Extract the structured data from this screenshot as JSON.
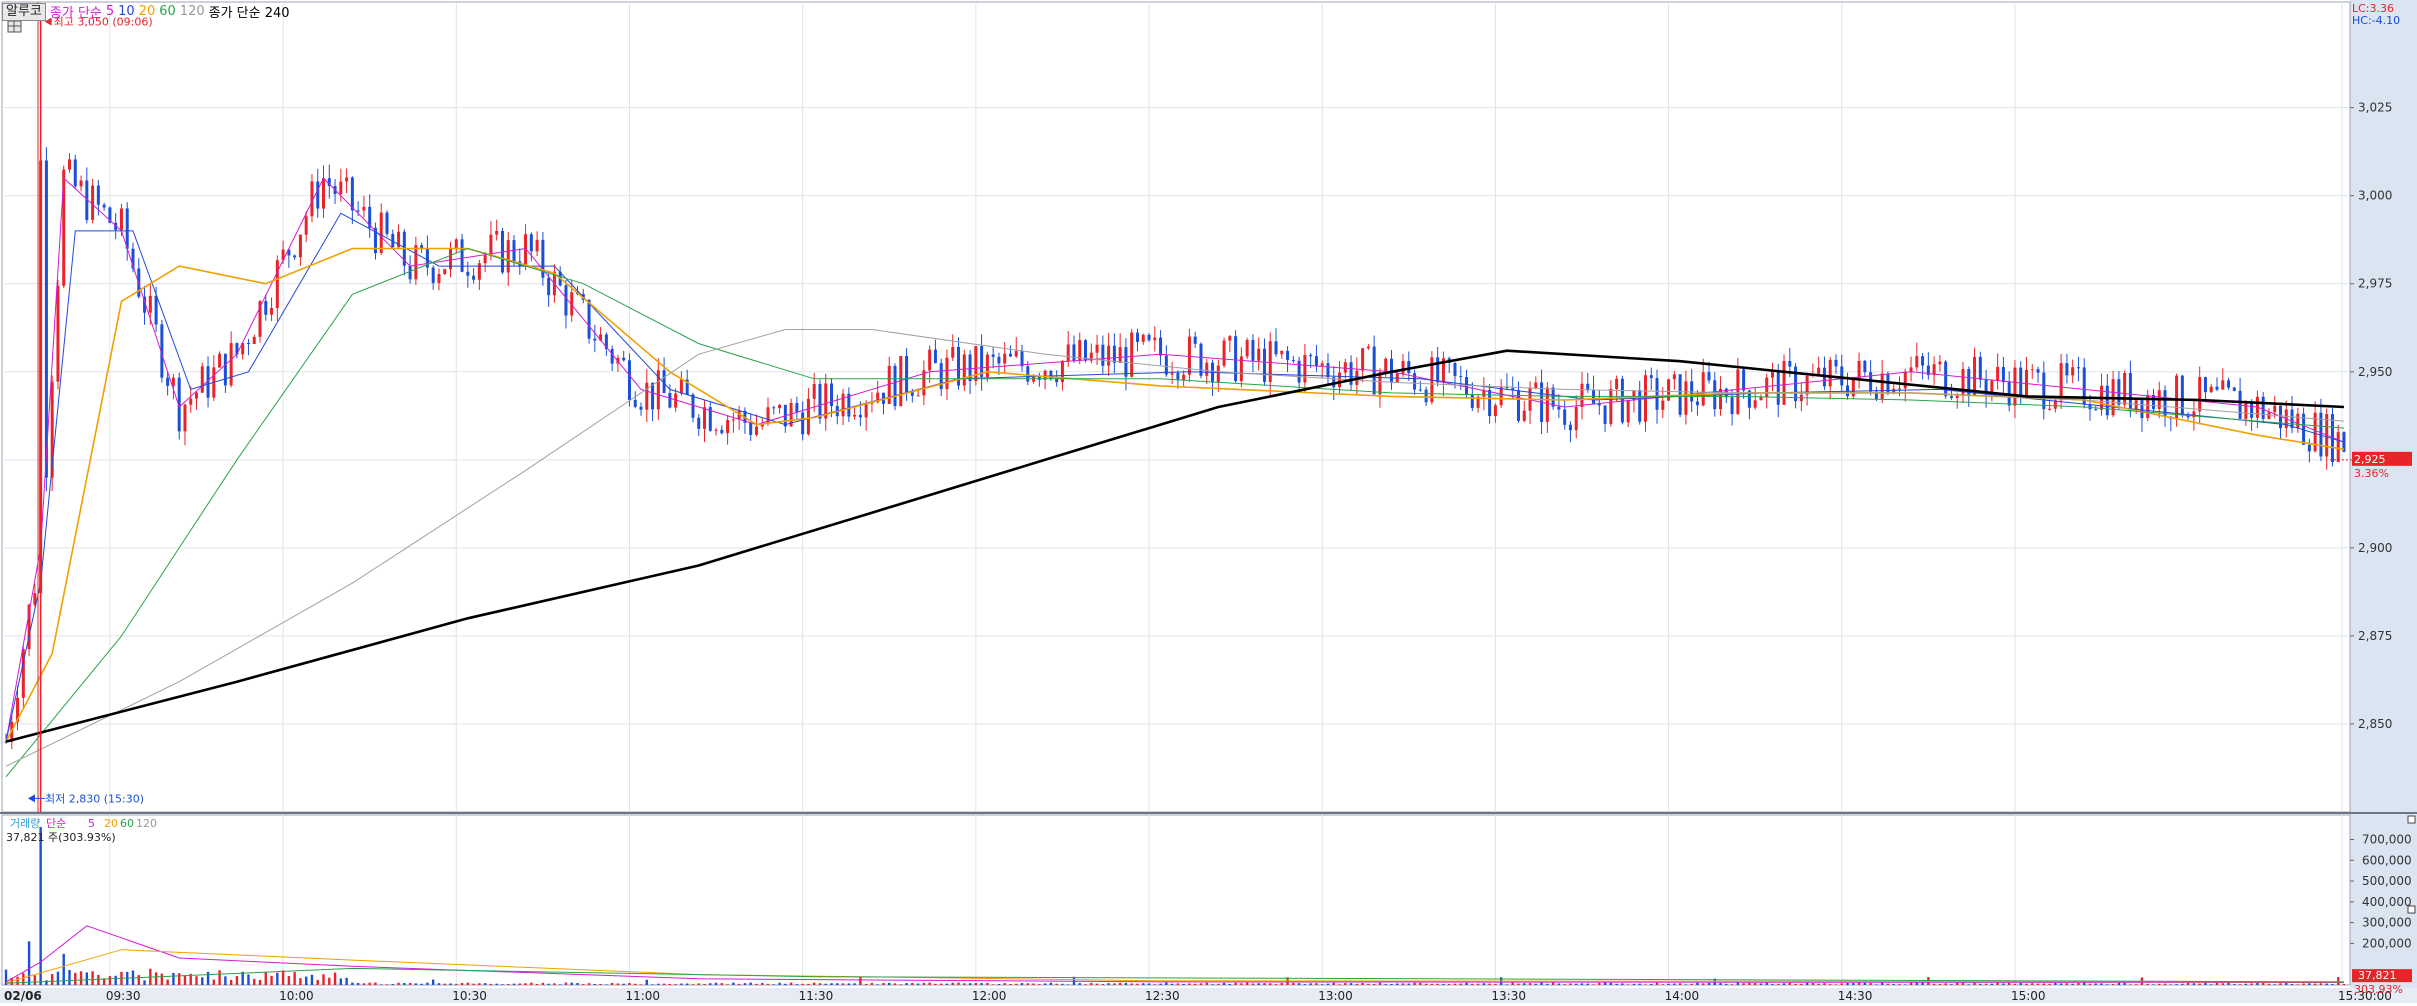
{
  "toolbar": {
    "stock_name": "알루코",
    "ma_label": "종가 단순",
    "ma_periods": [
      "5",
      "10",
      "20",
      "60",
      "120"
    ],
    "ma_long_label": "종가 단순 240"
  },
  "corner": {
    "lc": "LC:3.36",
    "hc": "HC:-4.10"
  },
  "annotations": {
    "high": "최고 3,050 (09:06)",
    "low": "최저 2,830 (15:30)"
  },
  "current": {
    "price": "2,925",
    "change_pct": "3.36%"
  },
  "volume_panel": {
    "label": "거래량",
    "ma_label": "단순",
    "ma_periods": [
      "5",
      "20",
      "60",
      "120"
    ],
    "info": "37,821 주(303.93%)",
    "current_value": "37,821",
    "current_pct": "303.93%"
  },
  "colors": {
    "up": "#e8232a",
    "down": "#1a4fd6",
    "ma5": "#d21bd6",
    "ma10": "#2448d8",
    "ma20": "#f0a000",
    "ma60": "#2aa24a",
    "ma120": "#a0a0a0",
    "ma240": "#000000"
  },
  "chart_data": {
    "type": "candlestick",
    "date": "02/06",
    "x_ticks": [
      "09:30",
      "10:00",
      "10:30",
      "11:00",
      "11:30",
      "12:00",
      "12:30",
      "13:00",
      "13:30",
      "14:00",
      "14:30",
      "15:00",
      "15:30:00"
    ],
    "y_ticks": [
      "2,850",
      "2,875",
      "2,900",
      "2,925",
      "2,950",
      "2,975",
      "3,000",
      "3,025"
    ],
    "ylim": [
      2825,
      3055
    ],
    "volume_ticks": [
      "200,000",
      "300,000",
      "400,000",
      "500,000",
      "600,000",
      "700,000"
    ],
    "volume_ylim": [
      0,
      760000
    ],
    "high": {
      "value": 3050,
      "time": "09:06"
    },
    "low": {
      "value": 2830,
      "time": "15:30"
    },
    "series": [
      {
        "name": "5",
        "points": [
          [
            0,
            2845
          ],
          [
            6,
            2900
          ],
          [
            10,
            3005
          ],
          [
            20,
            2990
          ],
          [
            30,
            2940
          ],
          [
            40,
            2955
          ],
          [
            55,
            3005
          ],
          [
            70,
            2980
          ],
          [
            90,
            2985
          ],
          [
            110,
            2945
          ],
          [
            130,
            2935
          ],
          [
            160,
            2950
          ],
          [
            200,
            2955
          ],
          [
            240,
            2950
          ],
          [
            270,
            2940
          ],
          [
            300,
            2945
          ],
          [
            330,
            2950
          ],
          [
            360,
            2945
          ],
          [
            390,
            2940
          ],
          [
            405,
            2930
          ]
        ]
      },
      {
        "name": "10",
        "points": [
          [
            0,
            2845
          ],
          [
            6,
            2890
          ],
          [
            12,
            2990
          ],
          [
            22,
            2990
          ],
          [
            32,
            2945
          ],
          [
            42,
            2950
          ],
          [
            58,
            2995
          ],
          [
            75,
            2980
          ],
          [
            95,
            2980
          ],
          [
            115,
            2945
          ],
          [
            135,
            2935
          ],
          [
            165,
            2948
          ],
          [
            205,
            2950
          ],
          [
            245,
            2948
          ],
          [
            275,
            2942
          ],
          [
            305,
            2944
          ],
          [
            335,
            2945
          ],
          [
            365,
            2940
          ],
          [
            395,
            2935
          ],
          [
            405,
            2930
          ]
        ]
      },
      {
        "name": "20",
        "points": [
          [
            0,
            2845
          ],
          [
            8,
            2870
          ],
          [
            20,
            2970
          ],
          [
            30,
            2980
          ],
          [
            45,
            2975
          ],
          [
            60,
            2985
          ],
          [
            80,
            2985
          ],
          [
            95,
            2978
          ],
          [
            115,
            2950
          ],
          [
            130,
            2935
          ],
          [
            140,
            2937
          ],
          [
            170,
            2950
          ],
          [
            200,
            2946
          ],
          [
            240,
            2943
          ],
          [
            270,
            2942
          ],
          [
            300,
            2944
          ],
          [
            330,
            2944
          ],
          [
            360,
            2942
          ],
          [
            390,
            2932
          ],
          [
            405,
            2928
          ]
        ]
      },
      {
        "name": "60",
        "points": [
          [
            0,
            2835
          ],
          [
            20,
            2875
          ],
          [
            40,
            2925
          ],
          [
            60,
            2972
          ],
          [
            80,
            2985
          ],
          [
            100,
            2975
          ],
          [
            120,
            2958
          ],
          [
            140,
            2948
          ],
          [
            170,
            2948
          ],
          [
            200,
            2948
          ],
          [
            240,
            2944
          ],
          [
            270,
            2943
          ],
          [
            300,
            2943
          ],
          [
            330,
            2942
          ],
          [
            360,
            2940
          ],
          [
            390,
            2936
          ],
          [
            405,
            2934
          ]
        ]
      },
      {
        "name": "120",
        "points": [
          [
            0,
            2838
          ],
          [
            30,
            2862
          ],
          [
            60,
            2890
          ],
          [
            90,
            2922
          ],
          [
            120,
            2955
          ],
          [
            135,
            2962
          ],
          [
            150,
            2962
          ],
          [
            180,
            2955
          ],
          [
            210,
            2950
          ],
          [
            240,
            2947
          ],
          [
            270,
            2945
          ],
          [
            300,
            2944
          ],
          [
            330,
            2944
          ],
          [
            360,
            2942
          ],
          [
            390,
            2938
          ],
          [
            405,
            2936
          ]
        ]
      },
      {
        "name": "240",
        "points": [
          [
            0,
            2845
          ],
          [
            40,
            2862
          ],
          [
            80,
            2880
          ],
          [
            120,
            2895
          ],
          [
            150,
            2910
          ],
          [
            180,
            2925
          ],
          [
            210,
            2940
          ],
          [
            240,
            2950
          ],
          [
            260,
            2956
          ],
          [
            290,
            2953
          ],
          [
            320,
            2948
          ],
          [
            350,
            2943
          ],
          [
            380,
            2942
          ],
          [
            405,
            2940
          ]
        ]
      }
    ]
  }
}
